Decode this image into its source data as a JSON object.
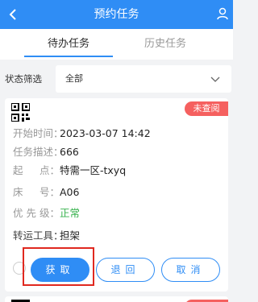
{
  "header": {
    "title": "预约任务",
    "back_icon": "chevron-left-icon",
    "user_icon": "user-icon"
  },
  "tabs": [
    {
      "label": "待办任务",
      "active": true
    },
    {
      "label": "历史任务",
      "active": false
    }
  ],
  "filter": {
    "label": "状态筛选",
    "selected": "全部"
  },
  "card": {
    "badge": "未查阅",
    "fields": [
      {
        "key": "开始时间：",
        "value": "2023-03-07 14:42"
      },
      {
        "key": "任务描述：",
        "value": "666"
      },
      {
        "key": "起 　 点：",
        "value": "特需一区-txyq"
      },
      {
        "key": "床 　 号：",
        "value": "A06"
      },
      {
        "key": "优 先 级：",
        "value": "正常"
      },
      {
        "key": "转运工具：",
        "value": "担架"
      }
    ],
    "buttons": {
      "fetch": "获取",
      "return": "退回",
      "cancel": "取消"
    }
  },
  "colors": {
    "primary": "#2f8df5",
    "badge": "#f5605f",
    "priority_normal": "#37b24d",
    "highlight": "#e0281f"
  }
}
